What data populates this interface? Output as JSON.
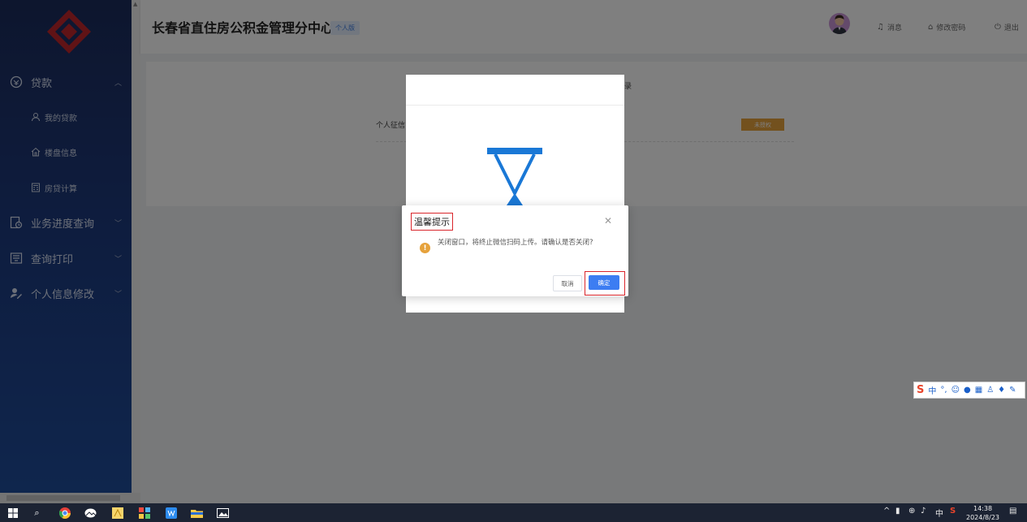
{
  "app": {
    "title": "长春省直住房公积金管理分中心",
    "badge": "个人版"
  },
  "header": {
    "messages": "消息",
    "change_password": "修改密码",
    "logout": "退出"
  },
  "sidebar": {
    "items": [
      {
        "label": "贷款",
        "icon": "loan-icon",
        "expanded": true,
        "children": [
          {
            "label": "我的贷款",
            "icon": "user-icon"
          },
          {
            "label": "楼盘信息",
            "icon": "building-icon"
          },
          {
            "label": "房贷计算",
            "icon": "calculator-icon"
          }
        ]
      },
      {
        "label": "业务进度查询",
        "icon": "progress-icon"
      },
      {
        "label": "查询打印",
        "icon": "print-icon"
      },
      {
        "label": "个人信息修改",
        "icon": "edit-user-icon"
      }
    ]
  },
  "background_page": {
    "row_label": "个人征信",
    "status": "未授权",
    "heading_tail": "录"
  },
  "confirm_dialog": {
    "title": "温馨提示",
    "message": "关闭窗口，将终止微信扫码上传。请确认是否关闭?",
    "cancel": "取消",
    "ok": "确定"
  },
  "ime": {
    "label": "中"
  },
  "taskbar": {
    "tray_lang": "中",
    "time": "14:38",
    "date": "2024/8/23"
  },
  "colors": {
    "sidebar": "#1d3a7e",
    "primary": "#3c7df2",
    "warning": "#e6a23c",
    "highlight": "#d9252b",
    "logo": "#c0262d"
  }
}
